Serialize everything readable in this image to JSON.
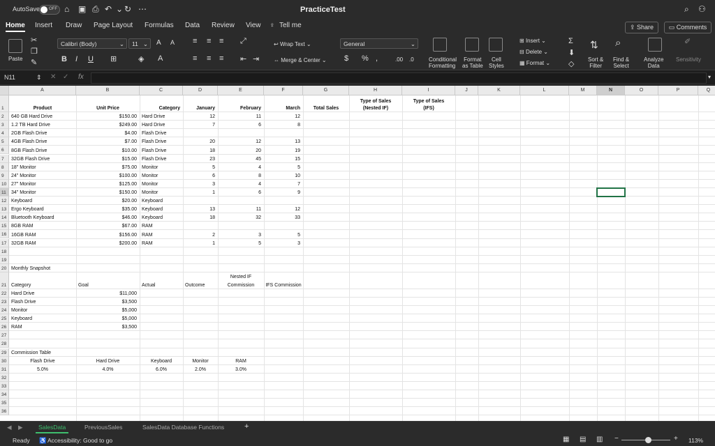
{
  "titlebar": {
    "autosave_label": "AutoSave",
    "toggle_state": "OFF",
    "doc_title": "PracticeTest"
  },
  "ribbon_tabs": [
    "Home",
    "Insert",
    "Draw",
    "Page Layout",
    "Formulas",
    "Data",
    "Review",
    "View"
  ],
  "tell_me": "Tell me",
  "share_label": "Share",
  "comments_label": "Comments",
  "home_ribbon": {
    "paste": "Paste",
    "font_name": "Calibri (Body)",
    "font_size": "11",
    "wrap_text": "Wrap Text",
    "merge_center": "Merge & Center",
    "number_format": "General",
    "conditional_formatting": [
      "Conditional",
      "Formatting"
    ],
    "format_as_table": [
      "Format",
      "as Table"
    ],
    "cell_styles": [
      "Cell",
      "Styles"
    ],
    "insert": "Insert",
    "delete": "Delete",
    "format": "Format",
    "sort_filter": [
      "Sort &",
      "Filter"
    ],
    "find_select": [
      "Find &",
      "Select"
    ],
    "analyze_data": [
      "Analyze",
      "Data"
    ],
    "sensitivity": "Sensitivity",
    "bold": "B",
    "italic": "I",
    "underline": "U",
    "font_grow": "A",
    "font_shrink": "A",
    "percent": "%",
    "comma": ",",
    "currency": "$",
    "dec_increase": ".00",
    "dec_decrease": ".0"
  },
  "formula_bar": {
    "name_box": "N11",
    "fx": "fx",
    "content": ""
  },
  "columns": [
    "A",
    "B",
    "C",
    "D",
    "E",
    "F",
    "G",
    "H",
    "I",
    "J",
    "K",
    "L",
    "M",
    "N",
    "O",
    "P",
    "Q"
  ],
  "selected_column": "N",
  "selected_row": "11",
  "rows": [
    "1",
    "2",
    "3",
    "4",
    "5",
    "6",
    "7",
    "8",
    "9",
    "10",
    "11",
    "12",
    "13",
    "14",
    "15",
    "16",
    "17",
    "18",
    "19",
    "20",
    "21",
    "22",
    "23",
    "24",
    "25",
    "26",
    "27",
    "28",
    "29",
    "30",
    "31",
    "32",
    "33",
    "34",
    "35",
    "36"
  ],
  "sheet": {
    "headers": [
      "Product",
      "Unit Price",
      "Category",
      "January",
      "February",
      "March",
      "Total Sales"
    ],
    "header_h": [
      "Type of Sales",
      "(Nested IF)"
    ],
    "header_i": [
      "Type of Sales",
      "(IFS)"
    ],
    "products": [
      {
        "name": "640 GB Hard Drive",
        "price": "$150.00",
        "cat": "Hard Drive",
        "jan": "12",
        "feb": "11",
        "mar": "12"
      },
      {
        "name": "1.2 TB Hard Drive",
        "price": "$249.00",
        "cat": "Hard Drive",
        "jan": "7",
        "feb": "6",
        "mar": "8"
      },
      {
        "name": "2GB Flash Drive",
        "price": "$4.00",
        "cat": "Flash Drive",
        "jan": "",
        "feb": "",
        "mar": ""
      },
      {
        "name": "4GB Flash Drive",
        "price": "$7.00",
        "cat": "Flash Drive",
        "jan": "20",
        "feb": "12",
        "mar": "13"
      },
      {
        "name": "8GB Flash Drive",
        "price": "$10.00",
        "cat": "Flash Drive",
        "jan": "18",
        "feb": "20",
        "mar": "19"
      },
      {
        "name": "32GB Flash Drive",
        "price": "$15.00",
        "cat": "Flash Drive",
        "jan": "23",
        "feb": "45",
        "mar": "15"
      },
      {
        "name": "18\" Monitor",
        "price": "$75.00",
        "cat": "Monitor",
        "jan": "5",
        "feb": "4",
        "mar": "5"
      },
      {
        "name": "24\" Monitor",
        "price": "$100.00",
        "cat": "Monitor",
        "jan": "6",
        "feb": "8",
        "mar": "10"
      },
      {
        "name": "27\" Monitor",
        "price": "$125.00",
        "cat": "Monitor",
        "jan": "3",
        "feb": "4",
        "mar": "7"
      },
      {
        "name": "34\" Monitor",
        "price": "$150.00",
        "cat": "Monitor",
        "jan": "1",
        "feb": "6",
        "mar": "9"
      },
      {
        "name": "Keyboard",
        "price": "$20.00",
        "cat": "Keyboard",
        "jan": "",
        "feb": "",
        "mar": ""
      },
      {
        "name": "Ergo Keyboard",
        "price": "$35.00",
        "cat": "Keyboard",
        "jan": "13",
        "feb": "11",
        "mar": "12"
      },
      {
        "name": "Bluetooth Keyboard",
        "price": "$46.00",
        "cat": "Keyboard",
        "jan": "18",
        "feb": "32",
        "mar": "33"
      },
      {
        "name": "8GB RAM",
        "price": "$67.00",
        "cat": "RAM",
        "jan": "",
        "feb": "",
        "mar": ""
      },
      {
        "name": "16GB RAM",
        "price": "$156.00",
        "cat": "RAM",
        "jan": "2",
        "feb": "3",
        "mar": "5"
      },
      {
        "name": "32GB RAM",
        "price": "$200.00",
        "cat": "RAM",
        "jan": "1",
        "feb": "5",
        "mar": "3"
      }
    ],
    "snapshot_title": "Monthly Snapshot",
    "snapshot_headers": [
      "Category",
      "Goal",
      "Actual",
      "Outcome",
      "Nested IF",
      "Commission",
      "IFS Commission"
    ],
    "snapshot_rows": [
      {
        "cat": "Hard Drive",
        "actual": "$11,000"
      },
      {
        "cat": "Flash Drive",
        "actual": "$3,500"
      },
      {
        "cat": "Monitor",
        "actual": "$5,000"
      },
      {
        "cat": "Keyboard",
        "actual": "$5,000"
      },
      {
        "cat": "RAM",
        "actual": "$3,500"
      }
    ],
    "commission_title": "Commission Table",
    "commission_headers": [
      "Flash Drive",
      "Hard Drive",
      "Keyboard",
      "Monitor",
      "RAM"
    ],
    "commission_values": [
      "5.0%",
      "4.0%",
      "6.0%",
      "2.0%",
      "3.0%"
    ]
  },
  "sheet_tabs": [
    "SalesData",
    "PreviousSales",
    "SalesData Database Functions"
  ],
  "add_sheet": "+",
  "status": {
    "ready": "Ready",
    "accessibility": "Accessibility: Good to go",
    "zoom": "113%"
  },
  "colors": {
    "accent_green": "#217346",
    "active_tab": "#3fbf6e",
    "chrome": "#2b2b2b"
  }
}
